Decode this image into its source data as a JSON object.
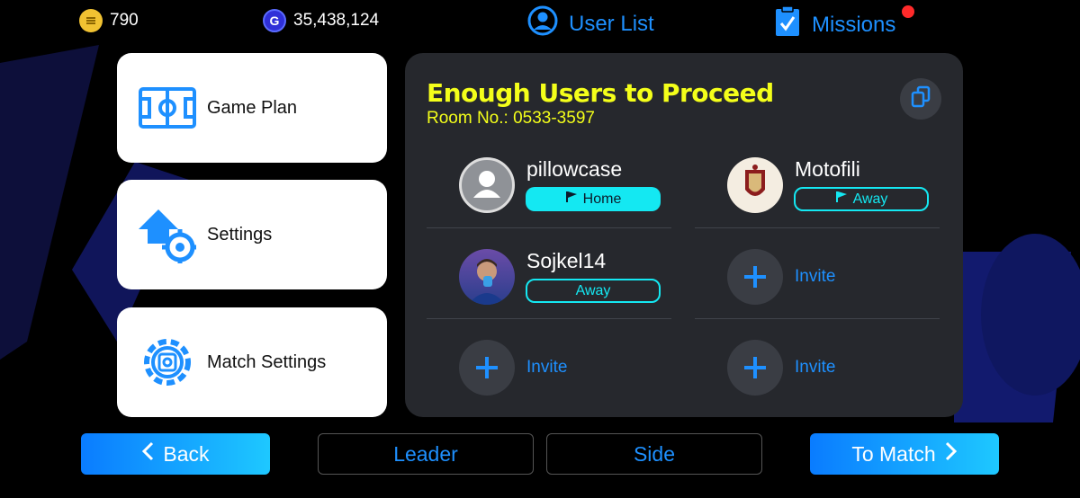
{
  "topbar": {
    "coins": "790",
    "gp": "35,438,124",
    "gp_letter": "G",
    "user_list_label": "User List",
    "missions_label": "Missions"
  },
  "menu": [
    {
      "label": "Game Plan",
      "icon": "game-plan-icon"
    },
    {
      "label": "Settings",
      "icon": "settings-icon"
    },
    {
      "label": "Match Settings",
      "icon": "match-settings-icon"
    }
  ],
  "room": {
    "title": "Enough Users to Proceed",
    "room_no": "Room No.: 0533-3597",
    "slots": [
      {
        "name": "pillowcase",
        "side": "Home"
      },
      {
        "name": "Motofili",
        "side": "Away"
      },
      {
        "name": "Sojkel14",
        "side": "Away"
      },
      {
        "invite": "Invite"
      },
      {
        "invite": "Invite"
      },
      {
        "invite": "Invite"
      }
    ]
  },
  "footer": {
    "back": "Back",
    "leader": "Leader",
    "side": "Side",
    "to_match": "To Match"
  },
  "colors": {
    "accent_blue": "#1e90ff",
    "title_yellow": "#f4ff1a",
    "pill_cyan": "#14e8f2",
    "panel_bg": "#26282d"
  }
}
